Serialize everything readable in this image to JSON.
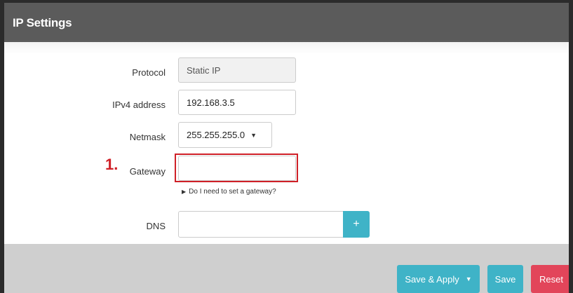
{
  "header": {
    "title": "IP Settings"
  },
  "form": {
    "protocol": {
      "label": "Protocol",
      "value": "Static IP"
    },
    "ipv4": {
      "label": "IPv4 address",
      "value": "192.168.3.5"
    },
    "netmask": {
      "label": "Netmask",
      "value": "255.255.255.0"
    },
    "gateway": {
      "label": "Gateway",
      "value": "",
      "hint": "Do I need to set a gateway?"
    },
    "dns": {
      "label": "DNS",
      "value": "",
      "add_label": "+"
    }
  },
  "annotation": {
    "step_number": "1.",
    "highlight_color": "#cf2027"
  },
  "footer": {
    "save_apply_label": "Save & Apply",
    "save_label": "Save",
    "reset_label": "Reset"
  },
  "colors": {
    "header_bg": "#5b5b5b",
    "accent": "#3fb3c7",
    "danger": "#e2455a",
    "footer_bg": "#cfcfcf"
  },
  "icons": {
    "dropdown": "caret-down-icon",
    "hint": "triangle-right-icon",
    "add": "plus-icon"
  }
}
